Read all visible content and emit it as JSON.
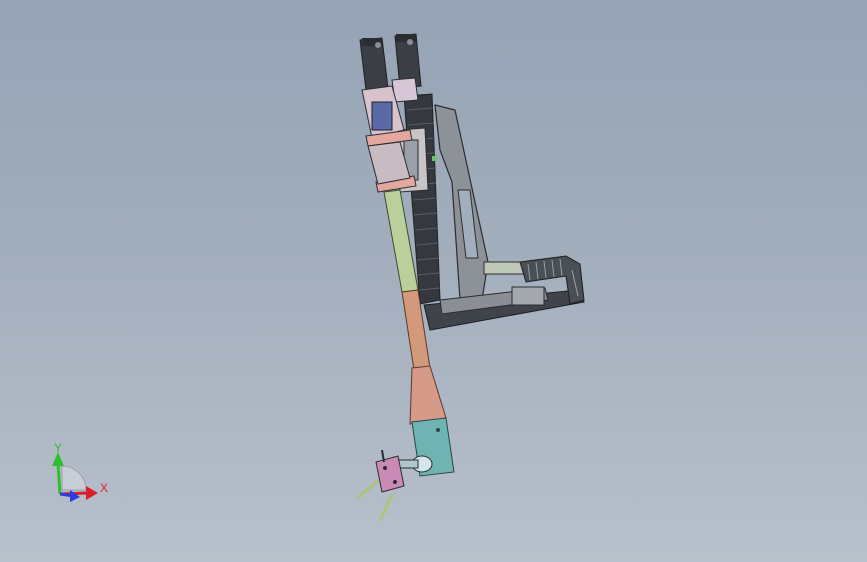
{
  "triad": {
    "x_label": "X",
    "y_label": "Y",
    "x_color": "#d8202a",
    "y_color": "#2ec02e",
    "z_color": "#2a3ee0"
  },
  "model": {
    "palette": {
      "tube_upper": "#b9d09a",
      "tube_lower": "#d29a7a",
      "cone": "#d59a88",
      "nozzle_block": "#6fb3b3",
      "frame_dark": "#3d4148",
      "plate_gray": "#8a8f96",
      "actuator": "#5a5f66",
      "clamp_pink": "#e6b5c5",
      "cable_green": "#a8c86a"
    }
  }
}
